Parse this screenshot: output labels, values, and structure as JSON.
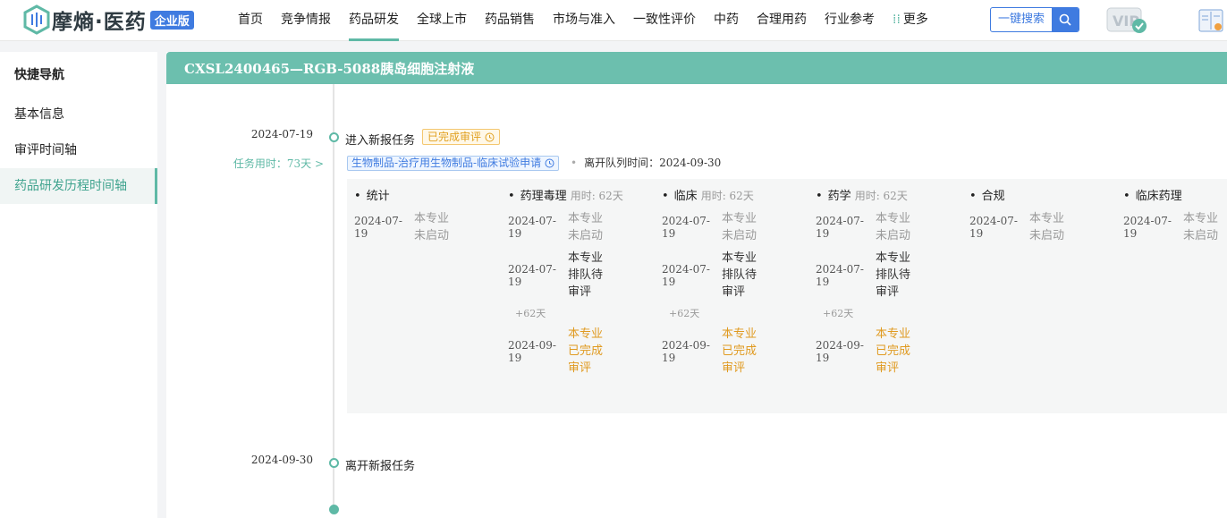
{
  "logo": {
    "text": "摩熵·医药",
    "badge": "企业版"
  },
  "nav": {
    "items": [
      "首页",
      "竞争情报",
      "药品研发",
      "全球上市",
      "药品销售",
      "市场与准入",
      "一致性评价",
      "中药",
      "合理用药",
      "行业参考"
    ],
    "more": "更多",
    "active_index": 2
  },
  "search": {
    "label": "一键搜索"
  },
  "sidebar": {
    "title": "快捷导航",
    "items": [
      "基本信息",
      "审评时间轴",
      "药品研发历程时间轴"
    ],
    "active_index": 2
  },
  "page": {
    "title": "CXSL2400465—RGB-5088胰岛细胞注射液"
  },
  "timeline": {
    "enter": {
      "date": "2024-07-19",
      "title": "进入新报任务",
      "status": "已完成审评",
      "task_time": "任务用时：73天 >",
      "category": "生物制品-治疗用生物制品-临床试验申请",
      "leave_label": "离开队列时间：2024-09-30"
    },
    "columns": [
      {
        "name": "统计",
        "used": "",
        "records": [
          {
            "date": "2024-07-19",
            "status": "本专业未启动",
            "type": "idle"
          }
        ]
      },
      {
        "name": "药理毒理",
        "used": "用时: 62天",
        "records": [
          {
            "date": "2024-07-19",
            "status": "本专业未启动",
            "type": "idle"
          },
          {
            "date": "2024-07-19",
            "status": "本专业排队待审评",
            "type": "queue"
          },
          {
            "plus": "+62天"
          },
          {
            "date": "2024-09-19",
            "status": "本专业已完成审评",
            "type": "done"
          }
        ]
      },
      {
        "name": "临床",
        "used": "用时: 62天",
        "records": [
          {
            "date": "2024-07-19",
            "status": "本专业未启动",
            "type": "idle"
          },
          {
            "date": "2024-07-19",
            "status": "本专业排队待审评",
            "type": "queue"
          },
          {
            "plus": "+62天"
          },
          {
            "date": "2024-09-19",
            "status": "本专业已完成审评",
            "type": "done"
          }
        ]
      },
      {
        "name": "药学",
        "used": "用时: 62天",
        "records": [
          {
            "date": "2024-07-19",
            "status": "本专业未启动",
            "type": "idle"
          },
          {
            "date": "2024-07-19",
            "status": "本专业排队待审评",
            "type": "queue"
          },
          {
            "plus": "+62天"
          },
          {
            "date": "2024-09-19",
            "status": "本专业已完成审评",
            "type": "done"
          }
        ]
      },
      {
        "name": "合规",
        "used": "",
        "records": [
          {
            "date": "2024-07-19",
            "status": "本专业未启动",
            "type": "idle"
          }
        ]
      },
      {
        "name": "临床药理",
        "used": "",
        "records": [
          {
            "date": "2024-07-19",
            "status": "本专业未启动",
            "type": "idle"
          }
        ]
      }
    ],
    "leave": {
      "date": "2024-09-30",
      "title": "离开新报任务"
    }
  },
  "colors": {
    "accent": "#6cbfae",
    "blue": "#3f7be0",
    "orange": "#e09a20"
  }
}
